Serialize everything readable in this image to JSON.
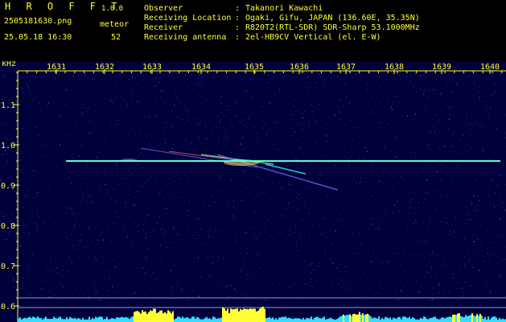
{
  "header": {
    "app_name": "H R O F F T",
    "version": "1.0.0",
    "filename": "2505181630.png",
    "mode": "meteor",
    "datetime": "25.05.18 16:30",
    "count": "52",
    "info": [
      {
        "label": "Observer",
        "value": "Takanori Kawachi"
      },
      {
        "label": "Receiving Location",
        "value": "Ogaki, Gifu, JAPAN (136.60E, 35.35N)"
      },
      {
        "label": "Receiver",
        "value": "R820T2(RTL-SDR) SDR-Sharp 53.1000MHz"
      },
      {
        "label": "Receiving antenna",
        "value": "2el-HB9CV Vertical (el. E-W)"
      }
    ]
  },
  "chart_data": {
    "type": "heatmap",
    "ylabel": "kHz",
    "x_ticks": [
      "1631",
      "1632",
      "1633",
      "1634",
      "1635",
      "1636",
      "1637",
      "1638",
      "1639",
      "1640"
    ],
    "y_ticks": [
      "1.1",
      "1.0",
      "0.9",
      "0.8",
      "0.7",
      "0.6"
    ],
    "carrier_khz": 0.96,
    "colors": {
      "background": "#00003a",
      "noise": "#2a2aa0",
      "signal": "#33ffee",
      "text": "#ffff33",
      "level_bar": "#33ddff"
    }
  }
}
